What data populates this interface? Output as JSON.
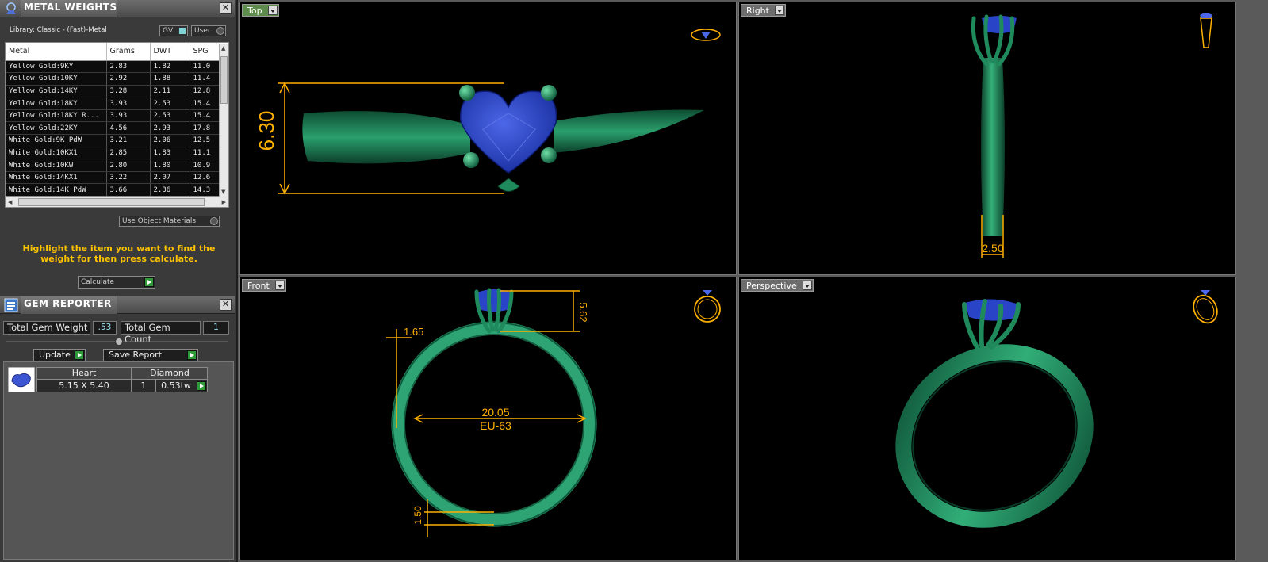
{
  "metal_weights": {
    "title": "METAL WEIGHTS",
    "library": "Library: Classic - (Fast)-Metal",
    "gv_label": "GV",
    "user_label": "User",
    "columns": [
      "Metal",
      "Grams",
      "DWT",
      "SPG"
    ],
    "rows": [
      [
        "Yellow Gold:9KY",
        "2.83",
        "1.82",
        "11.0"
      ],
      [
        "Yellow Gold:10KY",
        "2.92",
        "1.88",
        "11.4"
      ],
      [
        "Yellow Gold:14KY",
        "3.28",
        "2.11",
        "12.8"
      ],
      [
        "Yellow Gold:18KY",
        "3.93",
        "2.53",
        "15.4"
      ],
      [
        "Yellow Gold:18KY R...",
        "3.93",
        "2.53",
        "15.4"
      ],
      [
        "Yellow Gold:22KY",
        "4.56",
        "2.93",
        "17.8"
      ],
      [
        "White Gold:9K PdW",
        "3.21",
        "2.06",
        "12.5"
      ],
      [
        "White Gold:10KX1",
        "2.85",
        "1.83",
        "11.1"
      ],
      [
        "White Gold:10KW",
        "2.80",
        "1.80",
        "10.9"
      ],
      [
        "White Gold:14KX1",
        "3.22",
        "2.07",
        "12.6"
      ],
      [
        "White Gold:14K PdW",
        "3.66",
        "2.36",
        "14.3"
      ]
    ],
    "use_object_materials": "Use Object Materials",
    "instruction": "Highlight the item you want to find the weight for then press calculate.",
    "calculate_label": "Calculate"
  },
  "gem_reporter": {
    "title": "GEM REPORTER",
    "total_weight_label": "Total Gem Weight",
    "total_weight_value": ".53",
    "total_count_label": "Total Gem Count",
    "total_count_value": "1",
    "update_label": "Update",
    "save_report_label": "Save Report",
    "gem": {
      "shape": "Heart",
      "type": "Diamond",
      "size": "5.15 X 5.40",
      "count": "1",
      "weight": "0.53tw"
    }
  },
  "viewports": {
    "top": {
      "label": "Top",
      "dimension": "6.30"
    },
    "right": {
      "label": "Right",
      "dimension": "2.50"
    },
    "front": {
      "label": "Front",
      "dim_top": "5.62",
      "dim_left": "1.65",
      "dim_diameter": "20.05",
      "ring_size": "EU-63",
      "dim_bottom": "1.50"
    },
    "perspective": {
      "label": "Perspective"
    }
  },
  "colors": {
    "metal_green": "#1f8a5c",
    "gem_blue": "#2a44c8",
    "dimension_orange": "#ffb000",
    "active_tab": "#5d8c4d"
  }
}
